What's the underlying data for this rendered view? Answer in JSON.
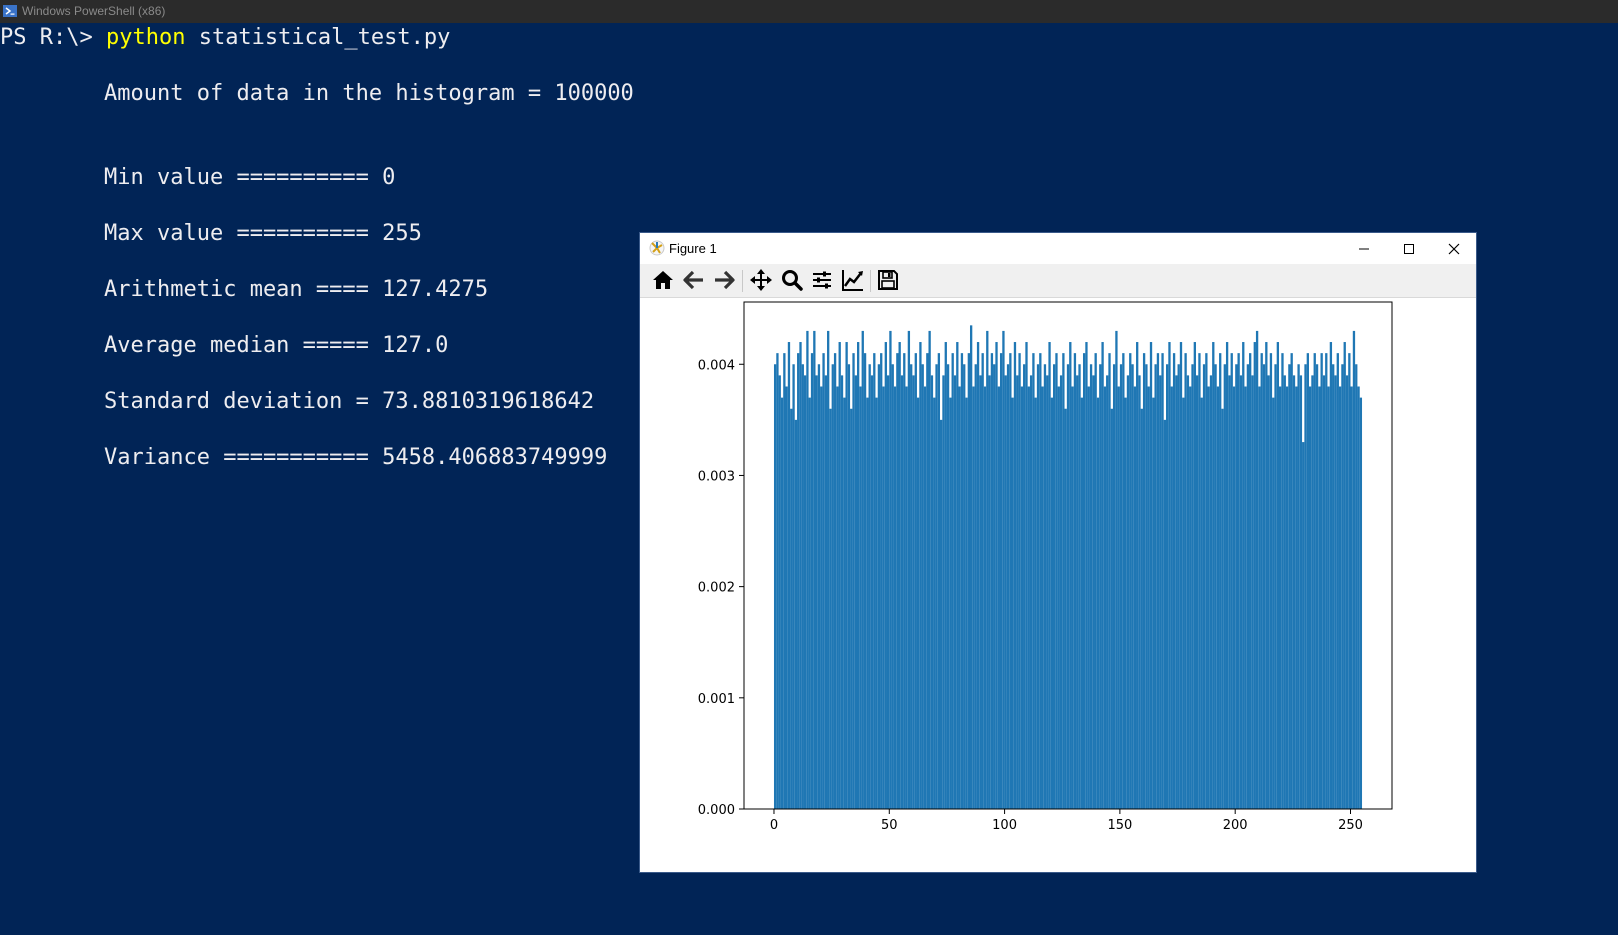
{
  "window": {
    "title": "Windows PowerShell (x86)"
  },
  "console": {
    "prompt": "PS R:\\> ",
    "command": "python",
    "argument": " statistical_test.py",
    "lines": [
      "Amount of data in the histogram = 100000",
      "Min value ========== 0",
      "Max value ========== 255",
      "Arithmetic mean ==== 127.4275",
      "Average median ===== 127.0",
      "Standard deviation = 73.8810319618642",
      "Variance =========== 5458.406883749999"
    ]
  },
  "figure": {
    "title": "Figure 1",
    "toolbar": [
      "home-icon",
      "back-icon",
      "forward-icon",
      "pan-icon",
      "zoom-icon",
      "configure-subplots-icon",
      "edit-axis-icon",
      "save-icon"
    ]
  },
  "chart_data": {
    "type": "bar",
    "title": "",
    "xlabel": "",
    "ylabel": "",
    "bar_color": "#1f77b4",
    "bin_start": 0,
    "bin_width": 1,
    "xlim": [
      -13,
      268
    ],
    "ylim": [
      0,
      0.00456
    ],
    "xticks": [
      0,
      50,
      100,
      150,
      200,
      250
    ],
    "xtick_labels": [
      "0",
      "50",
      "100",
      "150",
      "200",
      "250"
    ],
    "yticks": [
      0,
      0.001,
      0.002,
      0.003,
      0.004
    ],
    "ytick_labels": [
      "0.000",
      "0.001",
      "0.002",
      "0.003",
      "0.004"
    ],
    "values": [
      0.004,
      0.0041,
      0.0039,
      0.0037,
      0.0041,
      0.0038,
      0.0042,
      0.0036,
      0.004,
      0.0035,
      0.0041,
      0.0042,
      0.004,
      0.0039,
      0.0043,
      0.0037,
      0.0041,
      0.0043,
      0.0039,
      0.004,
      0.0038,
      0.0041,
      0.0039,
      0.0043,
      0.0036,
      0.004,
      0.0041,
      0.0038,
      0.0042,
      0.0039,
      0.0037,
      0.0042,
      0.004,
      0.0036,
      0.0041,
      0.0039,
      0.0042,
      0.0038,
      0.0043,
      0.0041,
      0.0037,
      0.004,
      0.0039,
      0.0041,
      0.0037,
      0.004,
      0.0041,
      0.0038,
      0.0042,
      0.0039,
      0.0043,
      0.004,
      0.0038,
      0.0041,
      0.0042,
      0.0039,
      0.0041,
      0.0038,
      0.0043,
      0.004,
      0.0039,
      0.0041,
      0.0037,
      0.0042,
      0.004,
      0.0038,
      0.0041,
      0.0043,
      0.0039,
      0.0037,
      0.004,
      0.0041,
      0.0035,
      0.0039,
      0.0042,
      0.004,
      0.0037,
      0.0041,
      0.0039,
      0.0042,
      0.0038,
      0.0041,
      0.004,
      0.0037,
      0.0041,
      0.00435,
      0.0038,
      0.004,
      0.0042,
      0.0039,
      0.0041,
      0.0038,
      0.0043,
      0.0039,
      0.0041,
      0.004,
      0.0042,
      0.0038,
      0.0041,
      0.0043,
      0.0039,
      0.004,
      0.0041,
      0.0037,
      0.0042,
      0.0039,
      0.0041,
      0.0038,
      0.004,
      0.0042,
      0.0038,
      0.0039,
      0.0041,
      0.0037,
      0.004,
      0.0041,
      0.0038,
      0.004,
      0.0039,
      0.0042,
      0.0037,
      0.004,
      0.0041,
      0.0038,
      0.0039,
      0.0041,
      0.0036,
      0.004,
      0.0042,
      0.0038,
      0.0041,
      0.0039,
      0.004,
      0.0037,
      0.0041,
      0.0042,
      0.0038,
      0.004,
      0.0039,
      0.0041,
      0.0037,
      0.004,
      0.0042,
      0.0038,
      0.0039,
      0.0041,
      0.0036,
      0.004,
      0.0043,
      0.0038,
      0.004,
      0.0041,
      0.0037,
      0.0039,
      0.0041,
      0.004,
      0.0038,
      0.0042,
      0.0039,
      0.0036,
      0.0041,
      0.004,
      0.0038,
      0.0042,
      0.0037,
      0.004,
      0.0041,
      0.0039,
      0.0041,
      0.0035,
      0.004,
      0.0042,
      0.0038,
      0.0041,
      0.0039,
      0.004,
      0.0042,
      0.0037,
      0.0041,
      0.0039,
      0.0038,
      0.004,
      0.0042,
      0.0039,
      0.0041,
      0.0037,
      0.004,
      0.0041,
      0.0038,
      0.0039,
      0.0042,
      0.004,
      0.0038,
      0.0041,
      0.0036,
      0.004,
      0.0042,
      0.0039,
      0.0041,
      0.0038,
      0.004,
      0.0041,
      0.0039,
      0.0042,
      0.0038,
      0.004,
      0.0041,
      0.0039,
      0.0042,
      0.0043,
      0.0038,
      0.0041,
      0.004,
      0.0042,
      0.0039,
      0.0041,
      0.0037,
      0.004,
      0.0042,
      0.0038,
      0.0041,
      0.0039,
      0.0038,
      0.004,
      0.0041,
      0.0039,
      0.0038,
      0.004,
      0.0039,
      0.0033,
      0.004,
      0.0041,
      0.0038,
      0.0039,
      0.0041,
      0.004,
      0.0038,
      0.0041,
      0.0039,
      0.0041,
      0.0038,
      0.0042,
      0.004,
      0.0039,
      0.0041,
      0.0038,
      0.004,
      0.0042,
      0.0039,
      0.0041,
      0.0038,
      0.0043,
      0.004,
      0.0038,
      0.0037
    ]
  }
}
